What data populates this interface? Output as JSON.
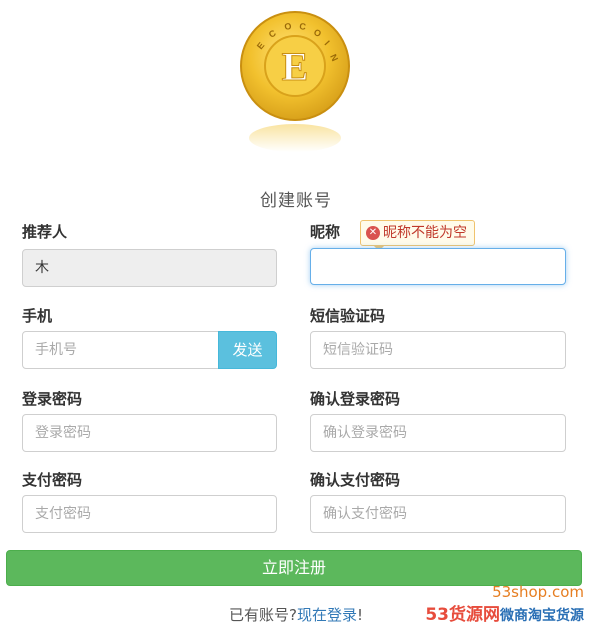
{
  "logo": {
    "letters": "ECOCOIN",
    "center_letter": "E",
    "colors": {
      "gold": "#f2c12e",
      "gold_dark": "#d9a21b"
    }
  },
  "page_title": "创建账号",
  "referrer": {
    "label": "推荐人",
    "value": "木"
  },
  "nickname": {
    "label": "昵称",
    "error": "昵称不能为空",
    "value": ""
  },
  "phone": {
    "label": "手机",
    "placeholder": "手机号",
    "send_label": "发送"
  },
  "sms_code": {
    "label": "短信验证码",
    "placeholder": "短信验证码"
  },
  "login_password": {
    "label": "登录密码",
    "placeholder": "登录密码"
  },
  "confirm_login_password": {
    "label": "确认登录密码",
    "placeholder": "确认登录密码"
  },
  "pay_password": {
    "label": "支付密码",
    "placeholder": "支付密码"
  },
  "confirm_pay_password": {
    "label": "确认支付密码",
    "placeholder": "确认支付密码"
  },
  "submit_label": "立即注册",
  "login_prompt": {
    "text": "已有账号?",
    "link": "现在登录",
    "suffix": "!"
  },
  "watermark": {
    "url": "53shop.com",
    "main": "53货源网",
    "sub": "微商淘宝货源"
  },
  "colors": {
    "accent_info": "#5bc0de",
    "accent_success": "#5cb85c",
    "link": "#337ab7",
    "error": "#d9534f"
  }
}
